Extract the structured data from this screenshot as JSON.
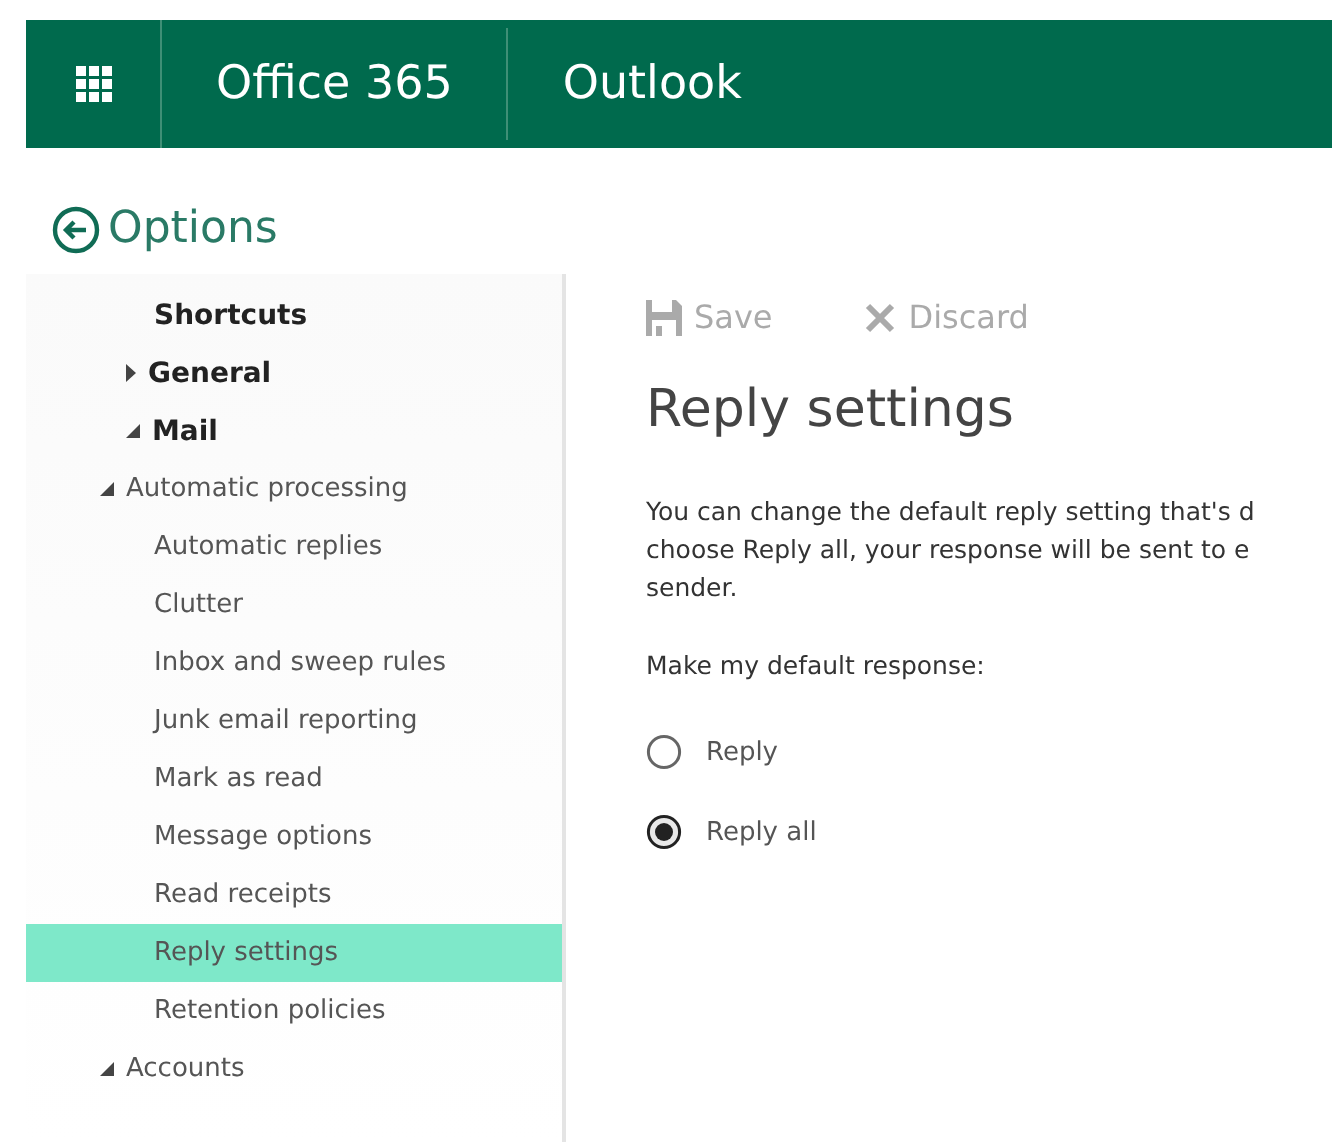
{
  "top_bar": {
    "suite": "Office 365",
    "app": "Outlook"
  },
  "page_title": "Options",
  "nav": [
    {
      "label": "Shortcuts",
      "selected": false
    },
    {
      "label": "General",
      "expanded": false,
      "selected": false
    },
    {
      "label": "Mail",
      "expanded": true,
      "selected": false,
      "children": [
        {
          "label": "Automatic processing",
          "expanded": true,
          "selected": false,
          "children": [
            {
              "label": "Automatic replies",
              "selected": false
            },
            {
              "label": "Clutter",
              "selected": false
            },
            {
              "label": "Inbox and sweep rules",
              "selected": false
            },
            {
              "label": "Junk email reporting",
              "selected": false
            },
            {
              "label": "Mark as read",
              "selected": false
            },
            {
              "label": "Message options",
              "selected": false
            },
            {
              "label": "Read receipts",
              "selected": false
            },
            {
              "label": "Reply settings",
              "selected": true
            },
            {
              "label": "Retention policies",
              "selected": false
            }
          ]
        },
        {
          "label": "Accounts",
          "expanded": true,
          "selected": false
        }
      ]
    }
  ],
  "toolbar": [
    {
      "label": "Save",
      "kind": "save",
      "disabled": true
    },
    {
      "label": "Discard",
      "kind": "discard",
      "disabled": true
    }
  ],
  "heading": "Reply settings",
  "description_lines": [
    "You can change the default reply setting that's d",
    "choose Reply all, your response will be sent to e",
    "sender."
  ],
  "prompt": "Make my default response:",
  "options": [
    {
      "label": "Reply",
      "selected": false
    },
    {
      "label": "Reply all",
      "selected": true
    }
  ]
}
